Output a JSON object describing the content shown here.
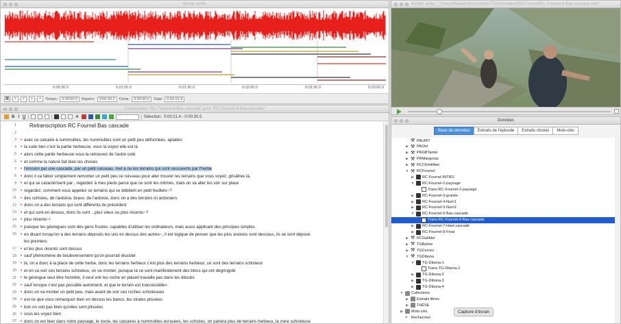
{
  "audio": {
    "title": "Bande audio",
    "ruler": [
      "0:00:30.0",
      "0:01:00.0",
      "0:01:30.0",
      "0:02:00.0",
      "0:02:30.0",
      "0:03:00.0"
    ],
    "tempo_label": "Tempo:",
    "tempo": "0:00:00.0",
    "repere_label": "Repère:",
    "repere": "0:00:30.2",
    "choix_label": "Choix:",
    "choix": "0:00:00.0",
    "total_label": "Total:",
    "total": "0:03:15.9"
  },
  "video": {
    "title": "Fichier vidéo : \"/Users/Messier/Documents/TRANS/videos/RCFournel/RC-Fournel-6-Bas-cascade.mp4\""
  },
  "transcript": {
    "title": "Transcription \"RC-Fournel-6-Bas-cascade\" pour \"RC-Fournel-6-Bas-cascade\"",
    "toolbar_buttons": [
      "B",
      "I",
      "U"
    ],
    "selection_label": "Sélection:",
    "selection": "0:00:21.4 - 0:00:30.5",
    "lines": [
      {
        "n": "1",
        "bullet": false,
        "text": "Retranscription RC Fournel Bas cascade",
        "heading": true
      },
      {
        "n": "2",
        "bullet": false,
        "text": ""
      },
      {
        "n": "3",
        "bullet": true,
        "text": "avec ce calcaire à nummulites, les nummulites sont un petit peu déformées, aplaties"
      },
      {
        "n": "4",
        "bullet": true,
        "text": "la suite ben c'est la partie herbeuse, vous la voyez elle est là"
      },
      {
        "n": "5",
        "bullet": true,
        "text": "alors cette partie herbeuse vous la retrouvez de l'autre coté"
      },
      {
        "n": "6",
        "bullet": true,
        "text": "et comme la nature fait bien les choses"
      },
      {
        "n": "7",
        "bullet": true,
        "text": "l'érosion par une cascade, par un petit ruisseau, met à nu les terrains qui sont recouverts par l'herbe",
        "selected": true
      },
      {
        "n": "8",
        "bullet": true,
        "text": "donc il va falloir simplement remonter un petit peu ce ruisseau pour aller trouver les terrains que vous voyez, grisâtres là,"
      },
      {
        "n": "9",
        "bullet": true,
        "text": "et qui se caractérisent par , regardez à mes pieds parce que ce sont les mêmes, mais on va aller les voir sur place"
      },
      {
        "n": "10",
        "bullet": true,
        "text": "regardez, comment vous appelez ce terrains qui se débitent en petit feuillets~?"
      },
      {
        "n": "11",
        "bullet": true,
        "text": "des schistes, de l'ardoise, bravo, de l'ardoise, donc on a des terrains ici ardoisiers"
      },
      {
        "n": "12",
        "bullet": true,
        "text": " donc on a des terrains qui sont différents du précédent"
      },
      {
        "n": "13",
        "bullet": true,
        "text": " et qui sont en dessus, donc ils sont ...plus vieux ou plus récents~?"
      },
      {
        "n": "14",
        "bullet": true,
        "text": " plus récents~!"
      },
      {
        "n": "15",
        "bullet": true,
        "text": " puisque les géologues sont des gens frustes, capables d'utiliser les ordinateurs, mais aussi applicant des principes simples"
      },
      {
        "n": "16",
        "bullet": true,
        "text": "en disant lorsqu'on a des terrains déposés les uns en dessus des autres~, il est logique de penser que les plus anciens sont dessous, ils se sont déposé"
      },
      {
        "n": "",
        "bullet": false,
        "text": "les premiers"
      },
      {
        "n": "17",
        "bullet": true,
        "text": "et les plus récents sont dessus"
      },
      {
        "n": "18",
        "bullet": true,
        "text": "sauf phénomène de bouleversement qu'on pourrait élucider"
      },
      {
        "n": "19",
        "bullet": true,
        "text": " là, on a donc à la place de cette herbe, donc les terrains herbeux c'est plus des terrains herbeux, ce sont des terrains schisteux"
      },
      {
        "n": "20",
        "bullet": true,
        "text": "et on va voir ces terrains schisteux, on va monter, puisque là ce sont manifestement des blocs qui ont dégringolé"
      },
      {
        "n": "21",
        "bullet": true,
        "text": " le géologue veut être honnête, il veut voir les roche en placeil travaille pas dans les éboulis"
      },
      {
        "n": "22",
        "bullet": true,
        "text": "sauf lorsque c'est pas possible autrement, et que le terrain est inaccessible«"
      },
      {
        "n": "23",
        "bullet": true,
        "text": "donc on va monter un petit peu, mais avant de voir ces roches schisteuses"
      },
      {
        "n": "24",
        "bullet": true,
        "text": "est-ce que vous remarquez bien en dessus les bancs, les strates plissées"
      },
      {
        "n": "25",
        "bullet": true,
        "text": " bon on voit pas bien qu'elles sont plissées"
      },
      {
        "n": "26",
        "bullet": true,
        "text": " vous les voyez bien"
      },
      {
        "n": "27",
        "bullet": true,
        "text": "donc on est bien dans notre paysage, le socle, les calcaires à nummulites écrasées, les schistes, on parlera plus de terrains herbeux, la zone schisteuse"
      }
    ]
  },
  "donnees": {
    "title": "Données",
    "tabs": [
      "Base de données",
      "Extraits de l'épisode",
      "Extraits choisis",
      "Mots-clés"
    ],
    "tree": [
      {
        "level": 1,
        "tri": "",
        "icon": "person-icon",
        "label": "PAUIRT"
      },
      {
        "level": 1,
        "tri": "▶",
        "icon": "person-icon",
        "label": "PASIvt"
      },
      {
        "level": 1,
        "tri": "▶",
        "icon": "person-icon",
        "label": "PRGBTamié"
      },
      {
        "level": 1,
        "tri": "▶",
        "icon": "person-icon",
        "label": "PRMargeriaz"
      },
      {
        "level": 1,
        "tri": "▶",
        "icon": "person-icon",
        "label": "RCChristillian"
      },
      {
        "level": 1,
        "tri": "▼",
        "icon": "person-icon",
        "label": "RCFournel"
      },
      {
        "level": 2,
        "tri": "▶",
        "icon": "camera-icon",
        "label": "RC Fournel INTRO"
      },
      {
        "level": 2,
        "tri": "▼",
        "icon": "camera-icon",
        "label": "RC-Fournel-2-paysage"
      },
      {
        "level": 3,
        "tri": "",
        "icon": "document-icon",
        "label": "Trans-RC-Fournel-2-paysage"
      },
      {
        "level": 2,
        "tri": "▶",
        "icon": "camera-icon",
        "label": "RC-Fournel-3-granite"
      },
      {
        "level": 2,
        "tri": "▶",
        "icon": "camera-icon",
        "label": "RC-Fournel-4-Num1"
      },
      {
        "level": 2,
        "tri": "▶",
        "icon": "camera-icon",
        "label": "RC-Fournel-5-Num2"
      },
      {
        "level": 2,
        "tri": "▼",
        "icon": "camera-icon",
        "label": "RC-Fournel-6-Bas-cascade"
      },
      {
        "level": 3,
        "tri": "",
        "icon": "document-icon",
        "label": "Trans-RC-Fournel-6-Bas-cascade",
        "selected": true
      },
      {
        "level": 2,
        "tri": "▶",
        "icon": "camera-icon",
        "label": "RC-Fournel-7-Haut-cascade"
      },
      {
        "level": 2,
        "tri": "▶",
        "icon": "camera-icon",
        "label": "RC-Fournel-8-Final"
      },
      {
        "level": 1,
        "tri": "▶",
        "icon": "person-icon",
        "label": "RCGalibier"
      },
      {
        "level": 1,
        "tri": "▶",
        "icon": "person-icon",
        "label": "TGBalme"
      },
      {
        "level": 1,
        "tri": "▶",
        "icon": "person-icon",
        "label": "TGCerces"
      },
      {
        "level": 1,
        "tri": "▼",
        "icon": "person-icon",
        "label": "TGDibona"
      },
      {
        "level": 2,
        "tri": "▼",
        "icon": "camera-icon",
        "label": "TG-Dibona-1"
      },
      {
        "level": 3,
        "tri": "",
        "icon": "document-icon",
        "label": "Trans-TG-Dibona-1"
      },
      {
        "level": 2,
        "tri": "▶",
        "icon": "camera-icon",
        "label": "TG-Dibona-2"
      },
      {
        "level": 2,
        "tri": "▶",
        "icon": "camera-icon",
        "label": "TG-Dibona-3"
      },
      {
        "level": 2,
        "tri": "▶",
        "icon": "camera-icon",
        "label": "TG-Dibona-4"
      },
      {
        "level": 0,
        "tri": "▼",
        "icon": "folder-icon",
        "label": "Collections"
      },
      {
        "level": 1,
        "tri": "▶",
        "icon": "folder-icon",
        "label": "Extraits libres"
      },
      {
        "level": 1,
        "tri": "▶",
        "icon": "folder-icon",
        "label": "THÈSE"
      },
      {
        "level": 0,
        "tri": "▶",
        "icon": "keywords-icon",
        "label": "Mots-clés"
      },
      {
        "level": 0,
        "tri": "",
        "icon": "search-icon",
        "label": "Rechercher"
      }
    ],
    "tooltip": "Capture d'écran"
  },
  "colors": {
    "waveform": "#e8201c",
    "selection": "#bcd6f2",
    "tree_selection": "#1f5bd4",
    "tab_selected": "#4a8fde",
    "bullet": "#d8453a"
  }
}
